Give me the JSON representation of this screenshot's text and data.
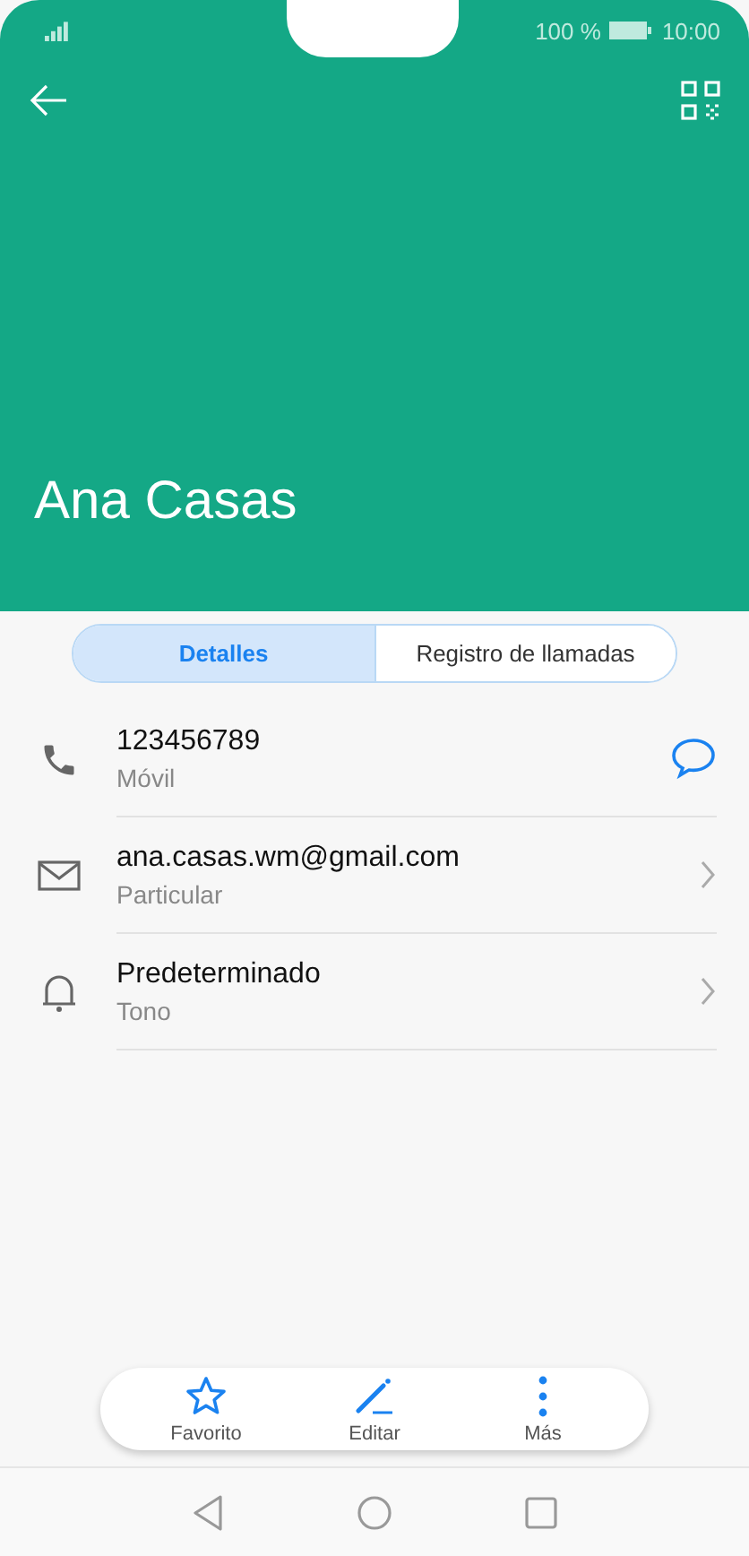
{
  "status_bar": {
    "battery": "100 %",
    "time": "10:00"
  },
  "contact": {
    "name": "Ana Casas"
  },
  "tabs": [
    {
      "label": "Detalles",
      "selected": true
    },
    {
      "label": "Registro de llamadas",
      "selected": false
    }
  ],
  "details": [
    {
      "kind": "phone",
      "value": "123456789",
      "label": "Móvil"
    },
    {
      "kind": "email",
      "value": "ana.casas.wm@gmail.com",
      "label": "Particular"
    },
    {
      "kind": "ringtone",
      "value": "Predeterminado",
      "label": "Tono"
    }
  ],
  "actions": [
    {
      "kind": "star",
      "label": "Favorito"
    },
    {
      "kind": "edit",
      "label": "Editar"
    },
    {
      "kind": "more",
      "label": "Más"
    }
  ]
}
